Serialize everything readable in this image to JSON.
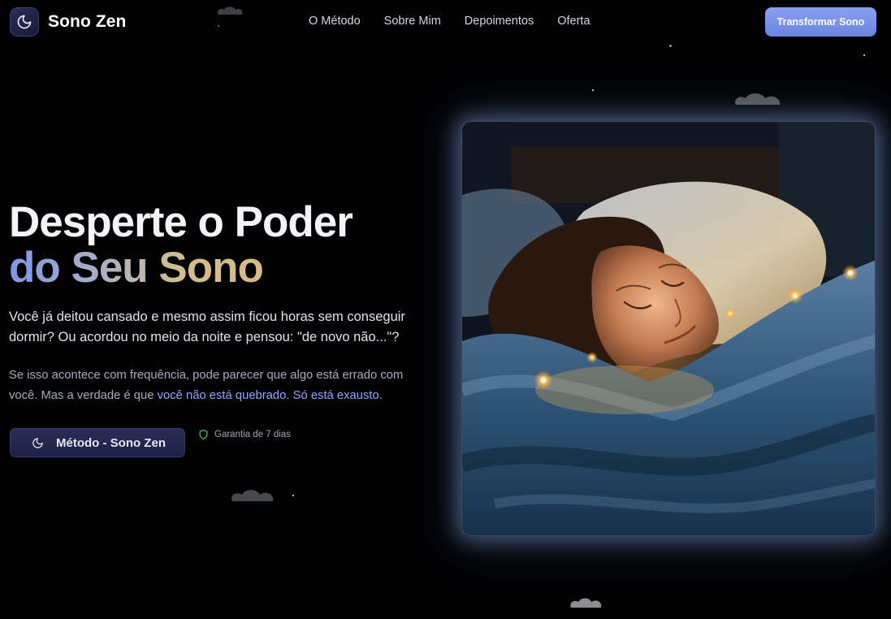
{
  "brand": {
    "name": "Sono Zen",
    "logo_icon": "moon-icon"
  },
  "nav": {
    "links": [
      "O Método",
      "Sobre Mim",
      "Depoimentos",
      "Oferta"
    ],
    "cta_label": "Transformar Sono"
  },
  "hero": {
    "headline_line1": "Desperte o Poder",
    "headline_line2": "do Seu Sono",
    "lead": "Você já deitou cansado e mesmo assim ficou horas sem conseguir dormir? Ou acordou no meio da noite e pensou: \"de novo não...\"?",
    "sub_text": "Se isso acontece com frequência, pode parecer que algo está errado com você. Mas a verdade é que ",
    "sub_highlight": "você não está quebrado. Só está exausto.",
    "cta_label": "Método - Sono Zen",
    "cta_icon": "moon-icon",
    "guarantee_label": "Garantia de 7 dias",
    "guarantee_icon": "shield-icon",
    "image_subject": "woman sleeping in blankets with warm fairy lights"
  },
  "colors": {
    "background": "#020203",
    "accent": "#7b93ea",
    "highlight_link": "#8fa7ff",
    "gradient_gold": "#d9b982"
  }
}
